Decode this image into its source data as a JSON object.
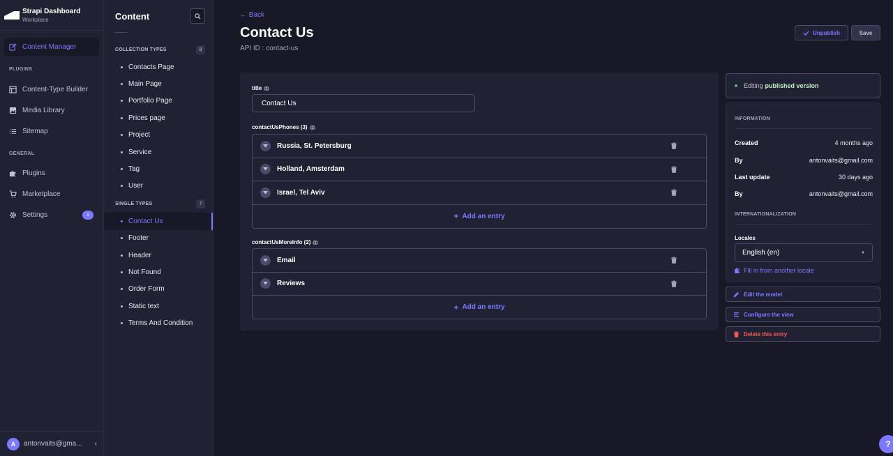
{
  "brand": {
    "title": "Strapi Dashboard",
    "subtitle": "Workplace"
  },
  "mainnav": {
    "content_manager": "Content Manager",
    "plugins_header": "PLUGINS",
    "content_type_builder": "Content-Type Builder",
    "media_library": "Media Library",
    "sitemap": "Sitemap",
    "general_header": "GENERAL",
    "plugins": "Plugins",
    "marketplace": "Marketplace",
    "settings": "Settings",
    "settings_badge": "1"
  },
  "user": {
    "initial": "A",
    "name": "antonvaits@gma..."
  },
  "subnav": {
    "title": "Content",
    "collection_header": "COLLECTION TYPES",
    "collection_count": "8",
    "collection_items": [
      "Contacts Page",
      "Main Page",
      "Portfolio Page",
      "Prices page",
      "Project",
      "Service",
      "Tag",
      "User"
    ],
    "single_header": "SINGLE TYPES",
    "single_count": "7",
    "single_items": [
      "Contact Us",
      "Footer",
      "Header",
      "Not Found",
      "Order Form",
      "Static text",
      "Terms And Condition"
    ]
  },
  "header": {
    "back": "Back",
    "title": "Contact Us",
    "api_id": "API ID : contact-us",
    "unpublish": "Unpublish",
    "save": "Save"
  },
  "form": {
    "title_label": "title",
    "title_value": "Contact Us",
    "phones_label": "contactUsPhones (3)",
    "phones": [
      "Russia, St. Petersburg",
      "Holland, Amsterdam",
      "Israel, Tel Aviv"
    ],
    "more_label": "contactUsMoreInfo (2)",
    "more": [
      "Email",
      "Reviews"
    ],
    "add_entry": "Add an entry"
  },
  "panel": {
    "status_prefix": "Editing",
    "status_strong": "published version",
    "info_header": "INFORMATION",
    "created_k": "Created",
    "created_v": "4 months ago",
    "by_k": "By",
    "created_by": "antonvaits@gmail.com",
    "updated_k": "Last update",
    "updated_v": "30 days ago",
    "updated_by": "antonvaits@gmail.com",
    "i18n_header": "INTERNATIONALIZATION",
    "locales_label": "Locales",
    "locale_value": "English (en)",
    "fill_link": "Fill in from another locale",
    "edit_model": "Edit the model",
    "configure_view": "Configure the view",
    "delete_entry": "Delete this entry"
  },
  "colors": {
    "accent": "#7b79ff",
    "danger": "#ee5e52",
    "success": "#5cb176"
  },
  "help": "?"
}
